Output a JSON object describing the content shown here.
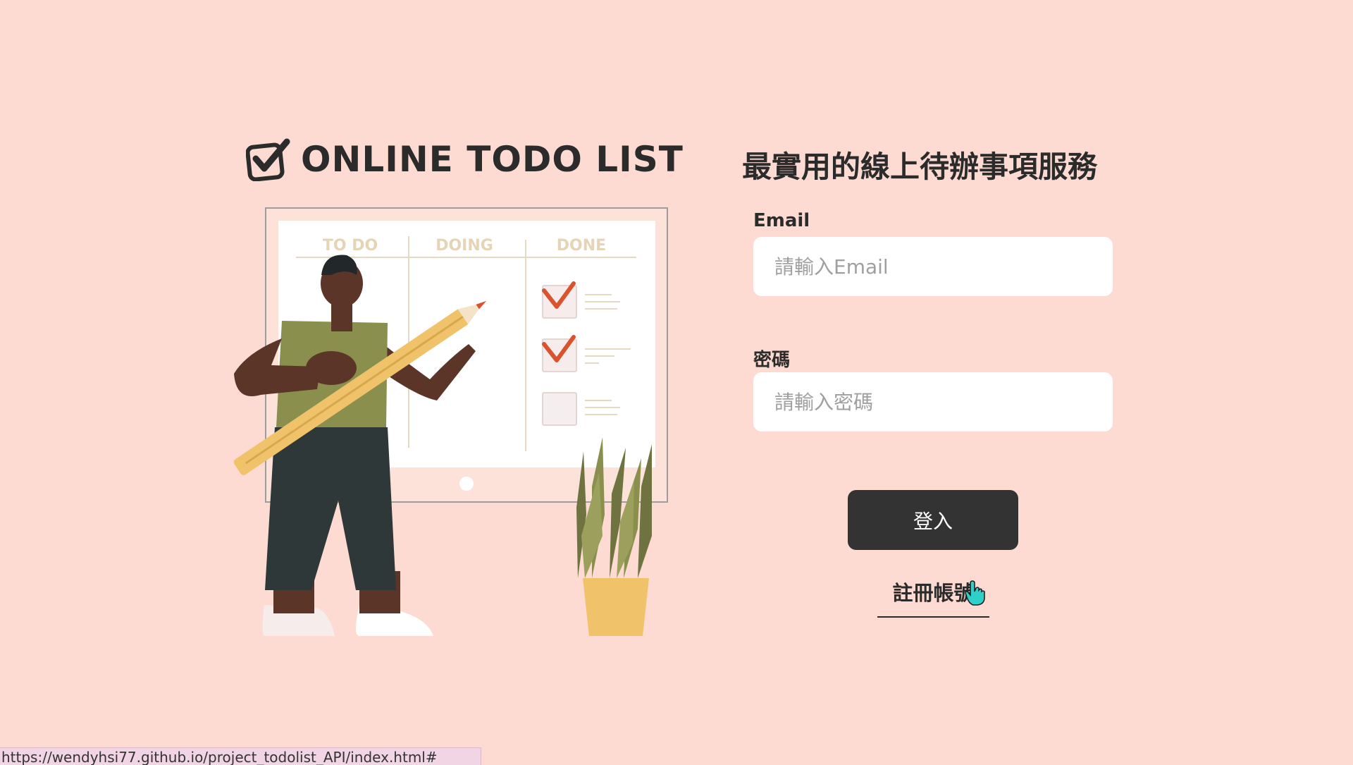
{
  "brand": {
    "logo_text": "ONLINE TODO LIST",
    "icon": "checkbox-check-icon"
  },
  "illustration": {
    "board_columns": [
      "TO DO",
      "DOING",
      "DONE"
    ],
    "done_checked": [
      true,
      true,
      false
    ]
  },
  "form": {
    "tagline": "最實用的線上待辦事項服務",
    "email_label": "Email",
    "email_placeholder": "請輸入Email",
    "email_value": "",
    "password_label": "密碼",
    "password_placeholder": "請輸入密碼",
    "password_value": "",
    "login_label": "登入",
    "signup_label": "註冊帳號"
  },
  "status_bar": {
    "url": "https://wendyhsi77.github.io/project_todolist_API/index.html#"
  },
  "colors": {
    "background": "#fddbd2",
    "button": "#333333",
    "check_red": "#d9532e",
    "plant_pot": "#f0c36a",
    "shirt": "#8a8f4e"
  }
}
